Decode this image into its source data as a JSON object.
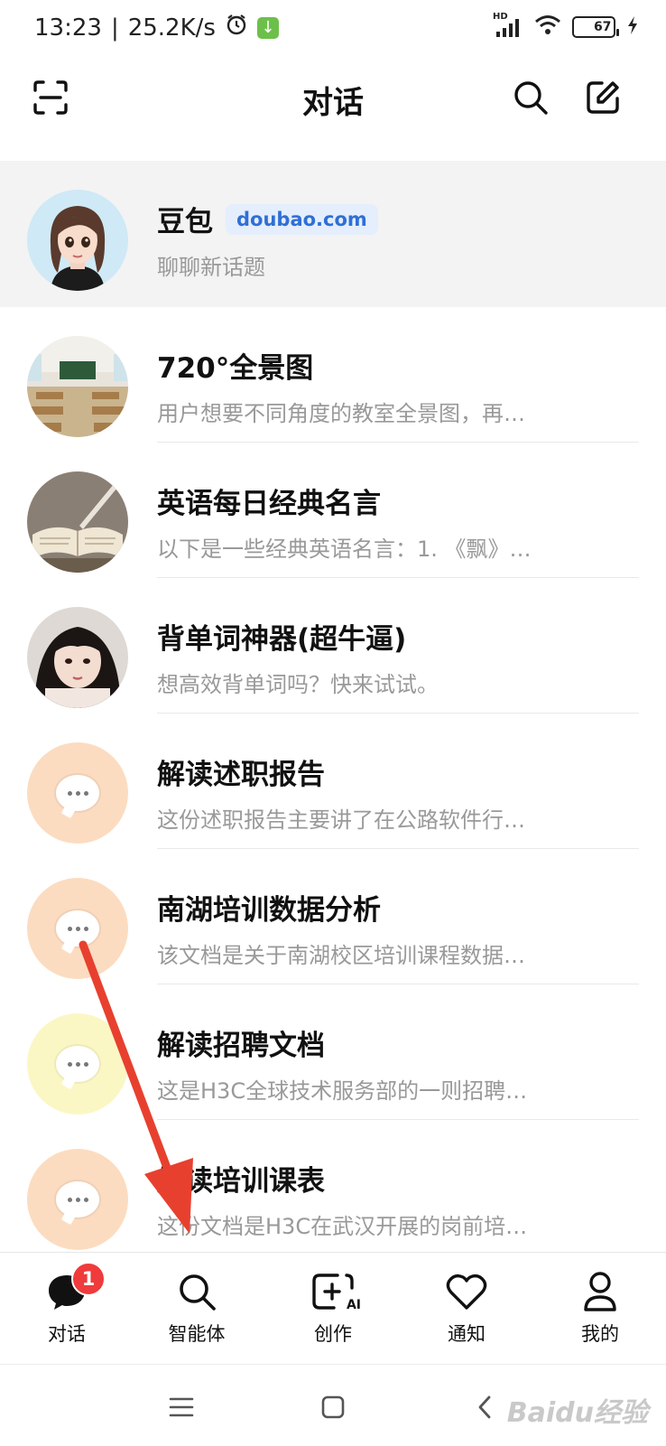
{
  "status": {
    "time": "13:23",
    "speed": "25.2K/s",
    "network": "HD",
    "battery": "67",
    "battery_level": 0.67
  },
  "header": {
    "title": "对话"
  },
  "chats": [
    {
      "title": "豆包",
      "badge": "doubao.com",
      "preview": "聊聊新话题"
    },
    {
      "title": "720°全景图",
      "preview": "用户想要不同角度的教室全景图，再…"
    },
    {
      "title": "英语每日经典名言",
      "preview": "以下是一些经典英语名言：1. 《飘》…"
    },
    {
      "title": "背单词神器(超牛逼)",
      "preview": "想高效背单词吗？快来试试。"
    },
    {
      "title": "解读述职报告",
      "preview": "这份述职报告主要讲了在公路软件行…"
    },
    {
      "title": "南湖培训数据分析",
      "preview": "该文档是关于南湖校区培训课程数据…"
    },
    {
      "title": "解读招聘文档",
      "preview": "这是H3C全球技术服务部的一则招聘…"
    },
    {
      "title": "解读培训课表",
      "preview": "这份文档是H3C在武汉开展的岗前培…"
    }
  ],
  "tabs": [
    {
      "label": "对话",
      "badge": "1"
    },
    {
      "label": "智能体"
    },
    {
      "label": "创作",
      "icon_text": "AI"
    },
    {
      "label": "通知"
    },
    {
      "label": "我的"
    }
  ],
  "watermark": "Baidu经验",
  "colors": {
    "badge_red": "#ef3b3b",
    "link_blue": "#2f6fd6",
    "avatar_peach": "#fcdcc0",
    "avatar_yellow": "#fbf7c4",
    "arrow_red": "#e8402f"
  }
}
